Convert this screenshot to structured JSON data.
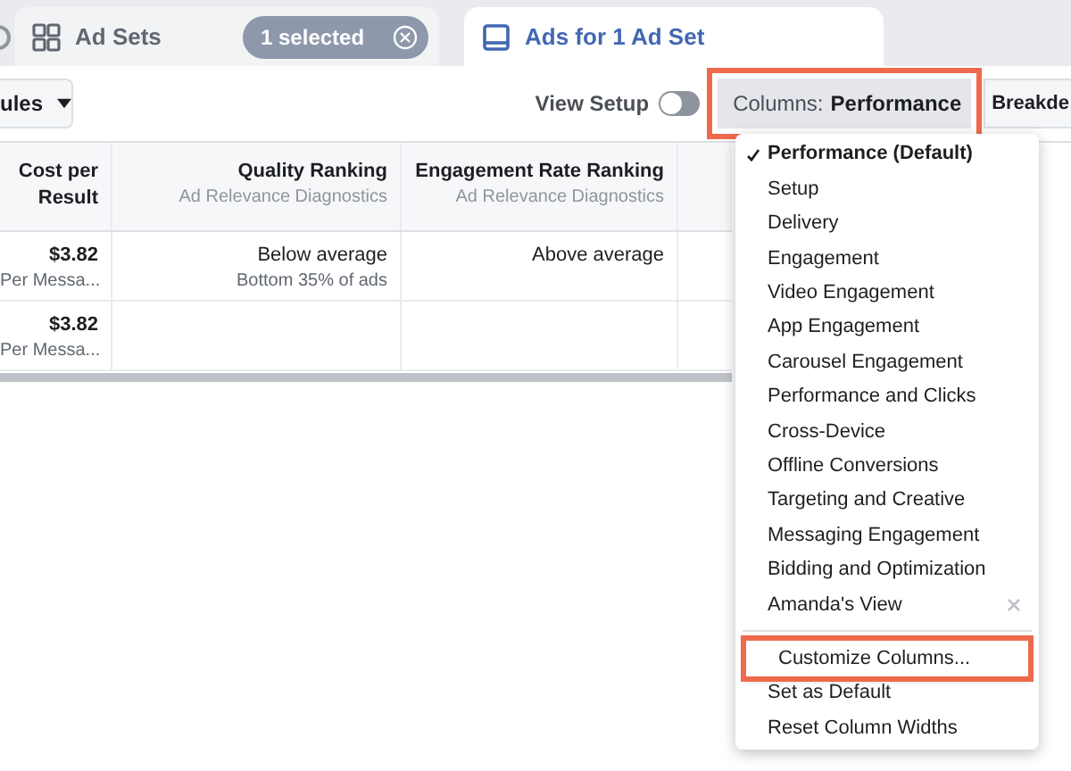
{
  "tabs": [
    {
      "label": "Ad Sets",
      "selected": false,
      "badge": "1 selected"
    },
    {
      "label": "Ads for 1 Ad Set",
      "selected": true
    }
  ],
  "toolbar": {
    "left_button": "ules",
    "view_setup": {
      "label": "View Setup",
      "on": false
    },
    "columns_button": {
      "label": "Columns:",
      "value": "Performance",
      "highlighted": true
    },
    "breakdown_button": "Breakde"
  },
  "table": {
    "columns": [
      {
        "title": "Cost per Result"
      },
      {
        "title": "Quality Ranking",
        "subtitle": "Ad Relevance Diagnostics"
      },
      {
        "title": "Engagement Rate Ranking",
        "subtitle": "Ad Relevance Diagnostics"
      }
    ],
    "rows": [
      {
        "cells": [
          {
            "value": "$3.82",
            "note": "Per Messa..."
          },
          {
            "value": "Below average",
            "note": "Bottom 35% of ads"
          },
          {
            "value": "Above average"
          }
        ]
      },
      {
        "cells": [
          {
            "value": "$3.82",
            "note": "Per Messa..."
          },
          {},
          {}
        ]
      }
    ]
  },
  "menu": {
    "views": [
      {
        "label": "Performance (Default)",
        "checked": true,
        "removable": false
      },
      {
        "label": "Setup",
        "checked": false,
        "removable": false
      },
      {
        "label": "Delivery",
        "checked": false,
        "removable": false
      },
      {
        "label": "Engagement",
        "checked": false,
        "removable": false
      },
      {
        "label": "Video Engagement",
        "checked": false,
        "removable": false
      },
      {
        "label": "App Engagement",
        "checked": false,
        "removable": false
      },
      {
        "label": "Carousel Engagement",
        "checked": false,
        "removable": false
      },
      {
        "label": "Performance and Clicks",
        "checked": false,
        "removable": false
      },
      {
        "label": "Cross-Device",
        "checked": false,
        "removable": false
      },
      {
        "label": "Offline Conversions",
        "checked": false,
        "removable": false
      },
      {
        "label": "Targeting and Creative",
        "checked": false,
        "removable": false
      },
      {
        "label": "Messaging Engagement",
        "checked": false,
        "removable": false
      },
      {
        "label": "Bidding and Optimization",
        "checked": false,
        "removable": false
      },
      {
        "label": "Amanda's View",
        "checked": false,
        "removable": true
      }
    ],
    "actions": [
      {
        "label": "Customize Columns...",
        "highlighted": true
      },
      {
        "label": "Set as Default",
        "highlighted": false
      },
      {
        "label": "Reset Column Widths",
        "highlighted": false
      }
    ]
  }
}
